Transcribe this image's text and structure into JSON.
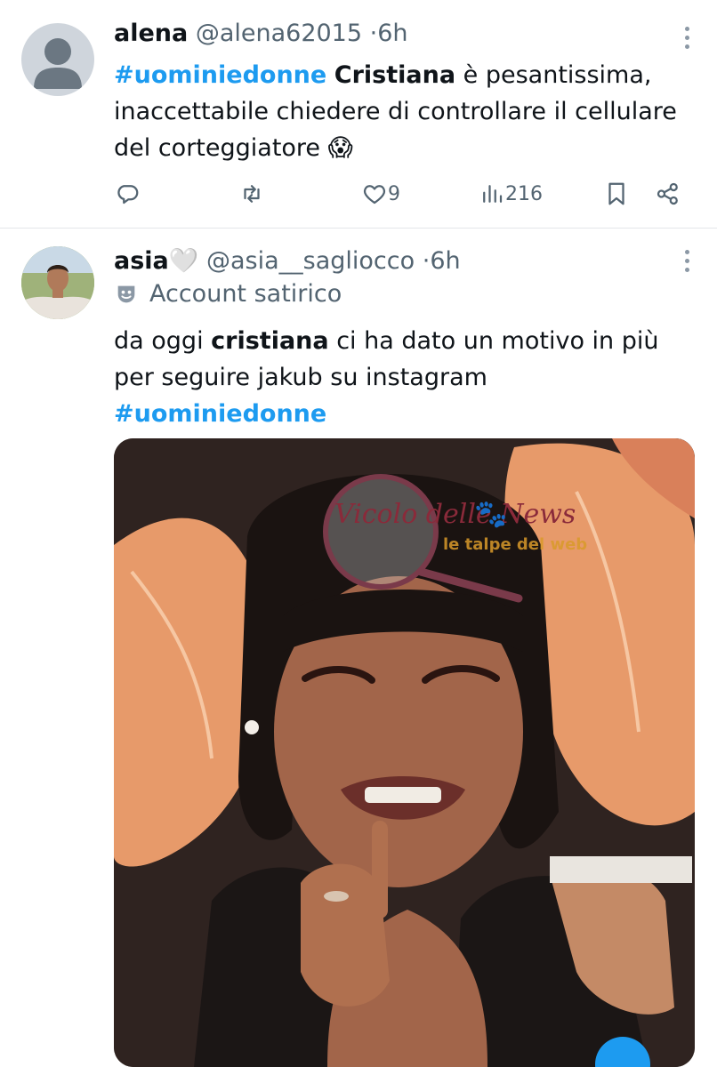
{
  "tweets": [
    {
      "name": "alena",
      "handle": "@alena62015",
      "time": "6h",
      "hashtag": "#uominiedonne",
      "bold_word": "Cristiana",
      "text_rest_1": " è  pesantissima,",
      "text_line_2": "inaccettabile chiedere di controllare il cellulare",
      "text_line_3": "del corteggiatore",
      "emoji": "😱",
      "likes": "9",
      "views": "216",
      "icons": [
        "reply-icon",
        "retweet-icon",
        "like-icon",
        "views-icon",
        "bookmark-icon",
        "share-icon"
      ]
    },
    {
      "name": "asia",
      "name_emoji": "🤍",
      "handle": "@asia__sagliocco",
      "time": "6h",
      "label": "Account satirico",
      "text_part_1": "da oggi ",
      "bold_word": "cristiana",
      "text_part_2": " ci ha dato un motivo in più",
      "text_line_2": "per seguire jakub su instagram",
      "hashtag": "#uominiedonne",
      "watermark_1": "Vicolo delle News",
      "watermark_2": "le talpe del web"
    }
  ],
  "colors": {
    "accent": "#1d9bf0",
    "secondary_text": "#536471",
    "divider": "#e3e6ea"
  }
}
